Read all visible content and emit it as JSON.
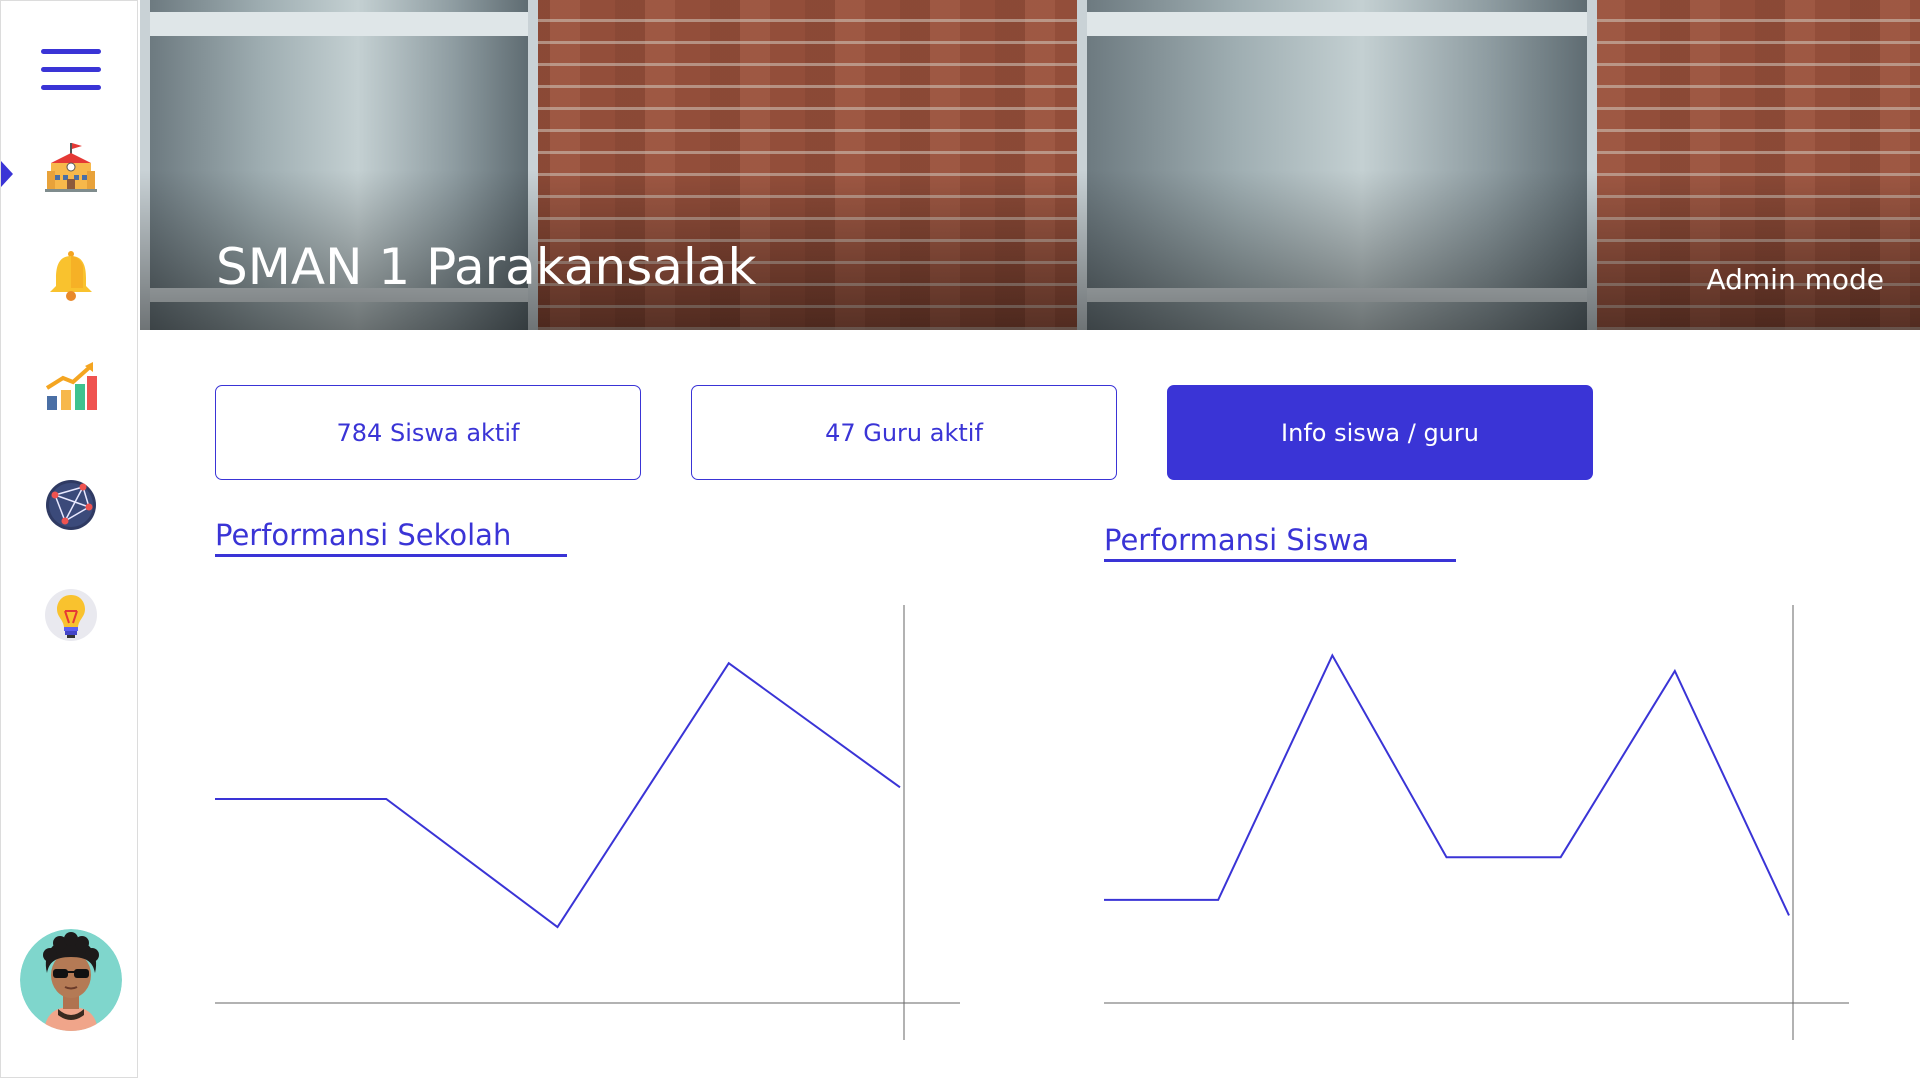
{
  "header": {
    "school_name": "SMAN 1 Parakansalak",
    "mode_label": "Admin mode"
  },
  "sidebar": {
    "menu_icon": "hamburger-menu-icon",
    "active_item": "school",
    "items": [
      {
        "id": "school",
        "icon": "school-icon"
      },
      {
        "id": "notifications",
        "icon": "bell-icon"
      },
      {
        "id": "statistics",
        "icon": "growth-chart-icon"
      },
      {
        "id": "network",
        "icon": "network-globe-icon"
      },
      {
        "id": "ideas",
        "icon": "lightbulb-icon"
      }
    ],
    "avatar_icon": "user-avatar-icon"
  },
  "stats": {
    "students_label": "784 Siswa aktif",
    "teachers_label": "47 Guru aktif",
    "info_label": "Info siswa / guru"
  },
  "colors": {
    "accent": "#3a34d6",
    "axis": "#666666"
  },
  "chart_data": [
    {
      "type": "line",
      "title": "Performansi Sekolah",
      "x": [
        0,
        1,
        2,
        3,
        4,
        5
      ],
      "series": [
        {
          "values": [
            50,
            50,
            17,
            85,
            53
          ]
        }
      ],
      "xlim": [
        0,
        5.5
      ],
      "ylim": [
        0,
        100
      ],
      "grid": false,
      "xlabel": "",
      "ylabel": ""
    },
    {
      "type": "line",
      "title": "Performansi Siswa",
      "x": [
        0,
        1,
        2,
        3,
        4,
        5,
        6,
        7
      ],
      "series": [
        {
          "values": [
            24,
            24,
            87,
            35,
            35,
            83,
            20
          ]
        }
      ],
      "xlim": [
        0,
        7.5
      ],
      "ylim": [
        0,
        100
      ],
      "grid": false,
      "xlabel": "",
      "ylabel": ""
    }
  ]
}
